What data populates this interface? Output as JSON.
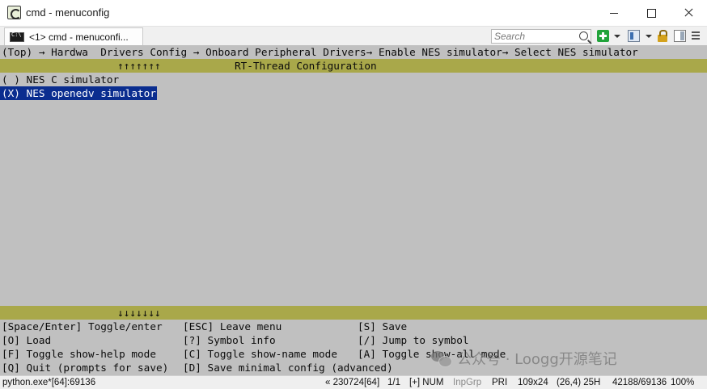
{
  "window": {
    "title": "cmd - menuconfig",
    "icon": "conemu-icon"
  },
  "toolbar": {
    "tab_label": "<1> cmd - menuconfi...",
    "search_placeholder": "Search",
    "icons": [
      "add-console-icon",
      "view-icon",
      "lock-icon",
      "panel-icon",
      "menu-icon"
    ]
  },
  "console": {
    "breadcrumb": "(Top) → Hardwa  Drivers Config → Onboard Peripheral Drivers→ Enable NES simulator→ Select NES simulator",
    "top_arrows": "↑↑↑↑↑↑↑",
    "bar_title": "RT-Thread Configuration",
    "options": [
      {
        "label": "( ) NES C simulator",
        "selected": false
      },
      {
        "label": "(X) NES openedv simulator",
        "selected": true
      }
    ],
    "bottom_arrows": "↓↓↓↓↓↓↓",
    "help": [
      [
        "[Space/Enter] Toggle/enter",
        "[ESC] Leave menu",
        "[S] Save"
      ],
      [
        "[O] Load",
        "[?] Symbol info",
        "[/] Jump to symbol"
      ],
      [
        "[F] Toggle show-help mode",
        "[C] Toggle show-name mode",
        "[A] Toggle show-all mode"
      ],
      [
        "[Q] Quit (prompts for save)",
        "[D] Save minimal config (advanced)",
        ""
      ]
    ],
    "colors": {
      "background": "#c0c0c0",
      "bar": "#a9a84a",
      "selection": "#0a2d8f"
    }
  },
  "watermark": {
    "text": "公众号 · Loogg开源笔记"
  },
  "statusbar": {
    "process": "python.exe*[64]:69136",
    "build": "« 230724[64]",
    "page": "1/1",
    "flags": "[+] NUM",
    "inpgrp": "InpGrp",
    "pri": "PRI",
    "size": "109x24",
    "cursor": "(26,4) 25H",
    "pid": "42188/69136",
    "zoom": "100%"
  }
}
